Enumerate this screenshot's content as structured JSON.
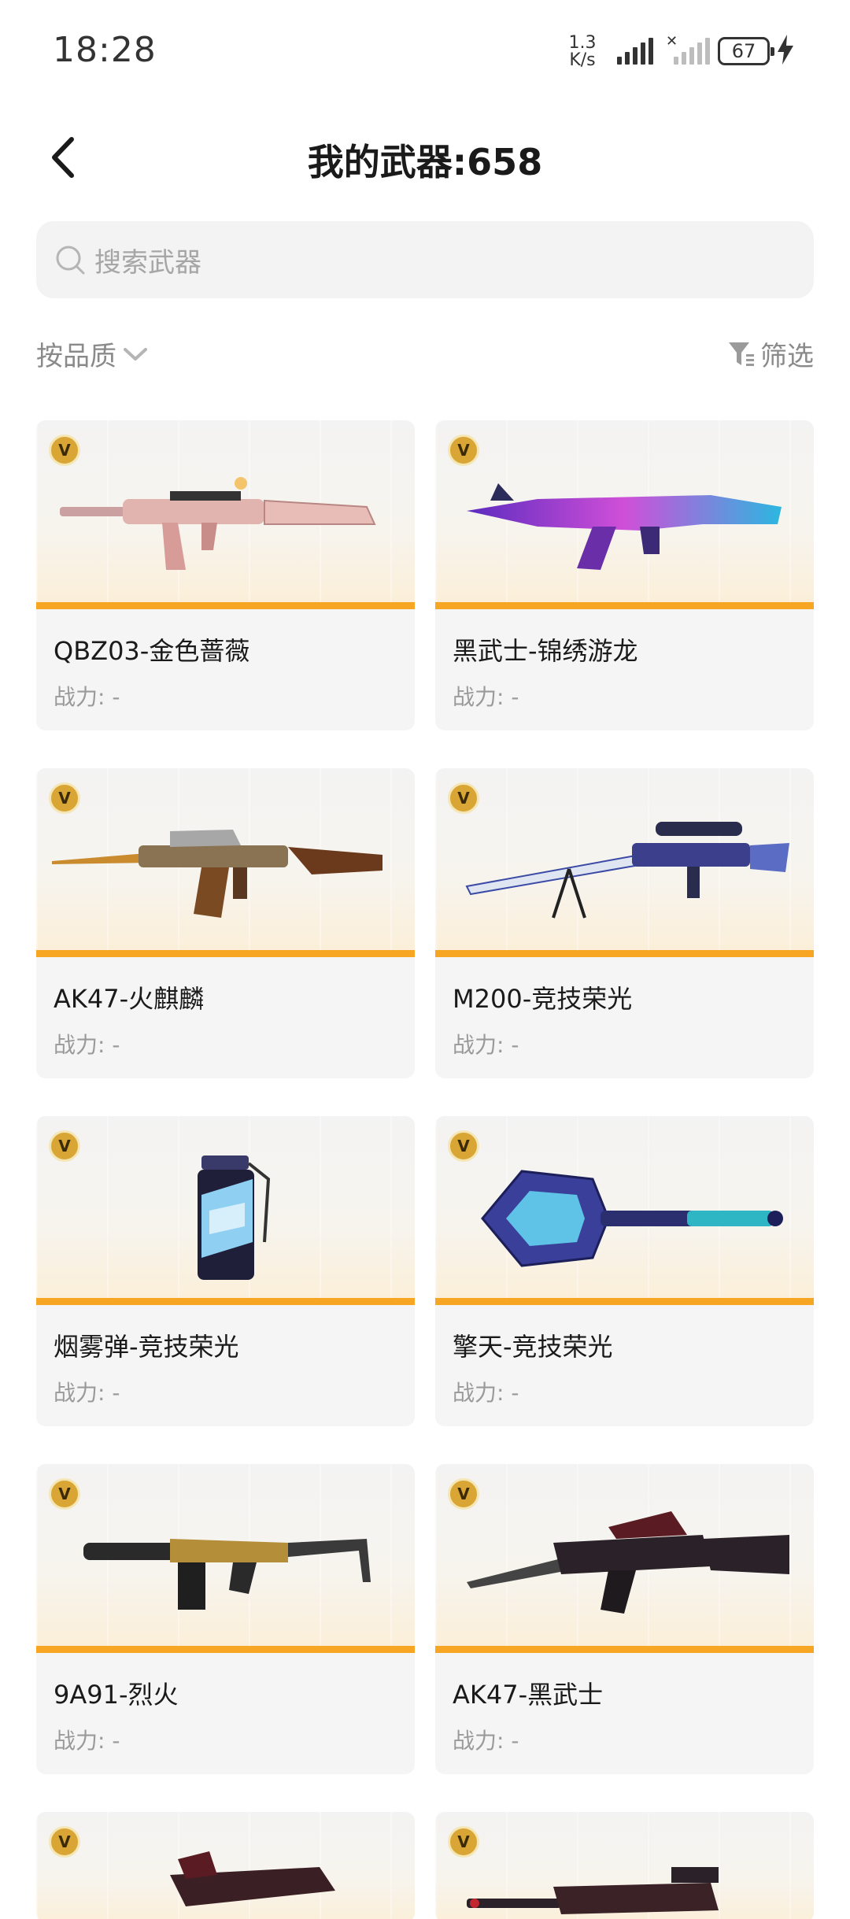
{
  "status_bar": {
    "time": "18:28",
    "speed_value": "1.3",
    "speed_unit": "K/s",
    "battery": "67"
  },
  "header": {
    "title": "我的武器:658"
  },
  "search": {
    "placeholder": "搜索武器"
  },
  "toolbar": {
    "sort_label": "按品质",
    "filter_label": "筛选"
  },
  "weapons": [
    {
      "name": "QBZ03-金色蔷薇",
      "power": "战力: -",
      "badge": "V"
    },
    {
      "name": "黑武士-锦绣游龙",
      "power": "战力: -",
      "badge": "V"
    },
    {
      "name": "AK47-火麒麟",
      "power": "战力: -",
      "badge": "V"
    },
    {
      "name": "M200-竞技荣光",
      "power": "战力: -",
      "badge": "V"
    },
    {
      "name": "烟雾弹-竞技荣光",
      "power": "战力: -",
      "badge": "V"
    },
    {
      "name": "擎天-竞技荣光",
      "power": "战力: -",
      "badge": "V"
    },
    {
      "name": "9A91-烈火",
      "power": "战力: -",
      "badge": "V"
    },
    {
      "name": "AK47-黑武士",
      "power": "战力: -",
      "badge": "V"
    },
    {
      "badge": "V"
    },
    {
      "badge": "V"
    }
  ],
  "colors": {
    "accent_bar": "#f6a623",
    "badge_gold": "#d9a635"
  }
}
